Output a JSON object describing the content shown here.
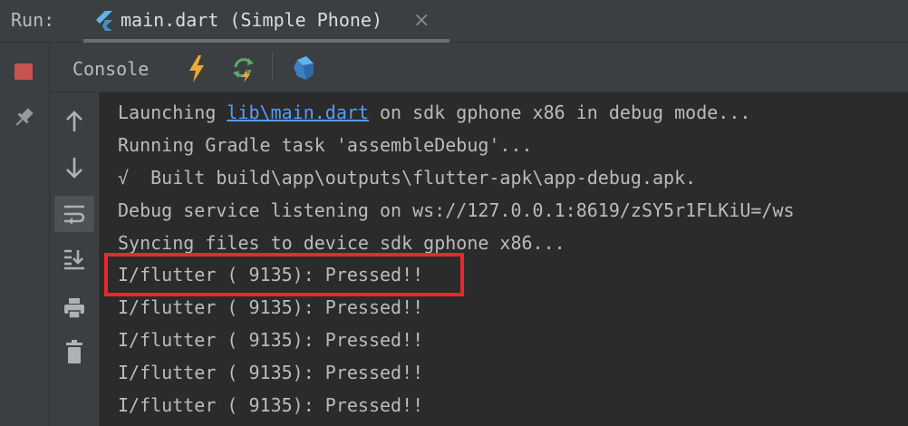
{
  "top_bar": {
    "run_label": "Run:",
    "tab_title": "main.dart (Simple Phone)",
    "tab_close": "×",
    "tab_icon": "flutter-icon"
  },
  "left_strip": {
    "stop_icon": "stop-icon",
    "pin_icon": "pin-icon",
    "stop_color": "#c75450"
  },
  "console_bar": {
    "label": "Console",
    "icons": [
      "hot-reload-bolt-icon",
      "hot-restart-icon",
      "dart-devtools-icon"
    ]
  },
  "side_toolbar": {
    "icons": [
      "arrow-up-icon",
      "arrow-down-icon",
      "soft-wrap-icon",
      "scroll-to-end-icon",
      "print-icon",
      "trash-icon"
    ]
  },
  "console": {
    "line1_prefix": "Launching ",
    "line1_link": "lib\\main.dart",
    "line1_suffix": " on sdk gphone x86 in debug mode...",
    "lines": [
      "Running Gradle task 'assembleDebug'...",
      "√  Built build\\app\\outputs\\flutter-apk\\app-debug.apk.",
      "Debug service listening on ws://127.0.0.1:8619/zSY5r1FLKiU=/ws",
      "Syncing files to device sdk gphone x86...",
      "I/flutter ( 9135): Pressed!!",
      "I/flutter ( 9135): Pressed!!",
      "I/flutter ( 9135): Pressed!!",
      "I/flutter ( 9135): Pressed!!",
      "I/flutter ( 9135): Pressed!!"
    ],
    "highlight_color": "#e8282f",
    "link_color": "#589df6"
  }
}
